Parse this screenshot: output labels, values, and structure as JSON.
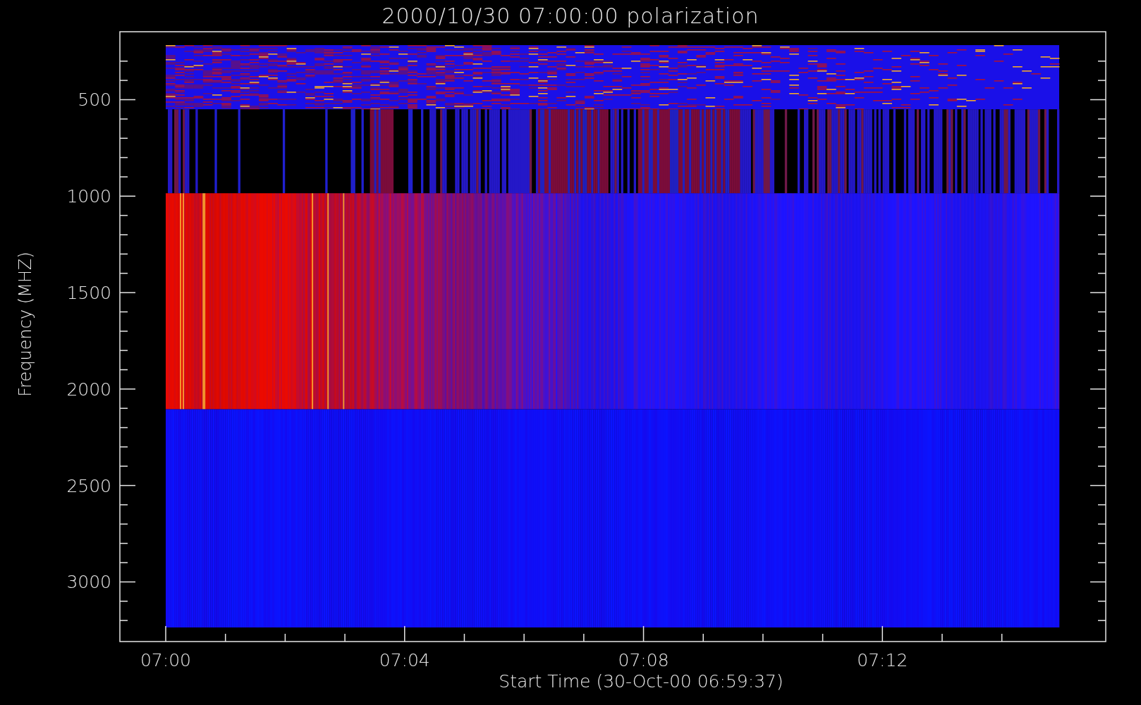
{
  "title": "2000/10/30 07:00:00 polarization",
  "y_axis": {
    "label": "Frequency (MHZ)",
    "ticks": [
      {
        "label": "500"
      },
      {
        "label": "1000"
      },
      {
        "label": "1500"
      },
      {
        "label": "2000"
      },
      {
        "label": "2500"
      },
      {
        "label": "3000"
      }
    ]
  },
  "x_axis": {
    "label": "Start Time (30-Oct-00 06:59:37)",
    "ticks": [
      {
        "label": "07:00"
      },
      {
        "label": "07:04"
      },
      {
        "label": "07:08"
      },
      {
        "label": "07:12"
      }
    ]
  }
}
